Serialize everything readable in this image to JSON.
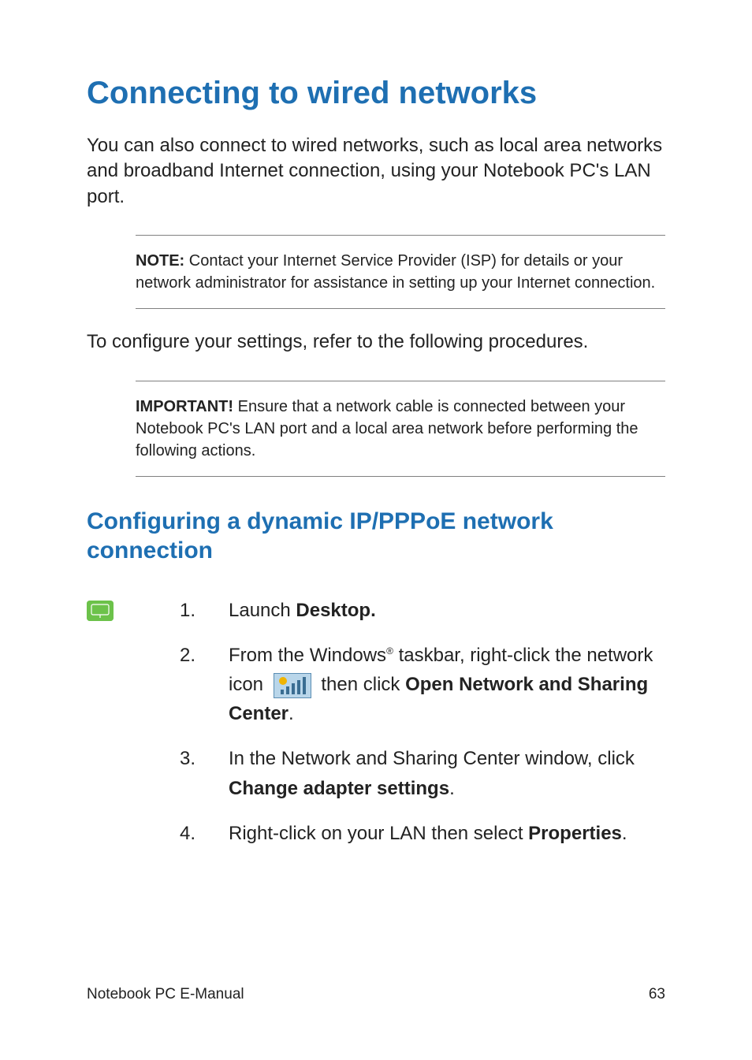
{
  "title": "Connecting to wired networks",
  "intro": "You can also connect to wired networks, such as local area networks and broadband Internet connection, using your Notebook PC's LAN port.",
  "note_label": "NOTE:",
  "note_text": " Contact your Internet Service Provider (ISP) for details or your network administrator for assistance in setting up your Internet connection.",
  "configure_text": "To configure your settings, refer to the following procedures.",
  "important_label": "IMPORTANT!",
  "important_text": "  Ensure that a network cable is connected between your Notebook PC's LAN port and a local area network before performing the following actions.",
  "subtitle": "Configuring a dynamic IP/PPPoE network connection",
  "steps": {
    "s1": {
      "num": "1.",
      "t1": "Launch ",
      "b1": "Desktop."
    },
    "s2": {
      "num": "2.",
      "t1": "From the Windows",
      "sup": "®",
      "t2": " taskbar, right-click the network icon ",
      "t3": " then click ",
      "b1": "Open Network and Sharing Center",
      "t4": "."
    },
    "s3": {
      "num": "3.",
      "t1": "In the Network and Sharing Center window, click ",
      "b1": "Change adapter settings",
      "t2": "."
    },
    "s4": {
      "num": "4.",
      "t1": "Right-click on your LAN then select ",
      "b1": "Properties",
      "t2": "."
    }
  },
  "footer": {
    "doc": "Notebook PC E-Manual",
    "page": "63"
  }
}
